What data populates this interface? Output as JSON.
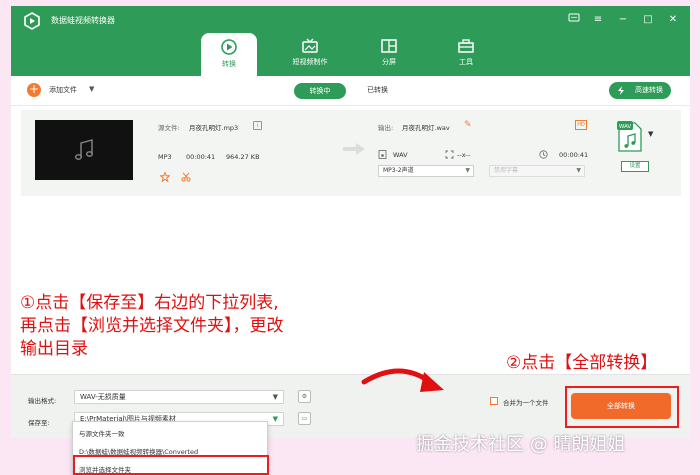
{
  "app": {
    "title": "数据蛙视频转换器"
  },
  "tabs": [
    {
      "label": "转换"
    },
    {
      "label": "短视频制作"
    },
    {
      "label": "分屏"
    },
    {
      "label": "工具"
    }
  ],
  "toolbar": {
    "add_file": "添加文件",
    "converting_tab": "转换中",
    "converted_tab": "已转换",
    "fast_convert": "高速转换"
  },
  "file": {
    "source_label": "源文件:",
    "source_name": "月夜孔明灯.mp3",
    "format": "MP3",
    "duration": "00:00:41",
    "size": "964.27 KB",
    "output_label": "输出:",
    "output_name": "月夜孔明灯.wav",
    "output_format": "WAV",
    "resolution": "--x--",
    "output_duration": "00:00:41",
    "audio_select": "MP3-2声道",
    "subtitle_select": "禁用字幕",
    "format_badge": "WAV",
    "settings": "设置"
  },
  "bottom": {
    "output_format_label": "输出格式:",
    "output_format_value": "WAV-无损质量",
    "save_to_label": "保存至:",
    "save_to_value": "E:\\PrMaterial\\图片与视频素材",
    "merge_label": "合并为一个文件",
    "convert_all": "全部转换"
  },
  "dropdown": {
    "items": [
      "与源文件夹一致",
      "D:\\数据蛙\\数据蛙视频转换器\\Converted",
      "浏览并选择文件夹"
    ]
  },
  "annotations": {
    "step1_line1": "①点击【保存至】右边的下拉列表,",
    "step1_line2": "再点击【浏览并选择文件夹】，更改",
    "step1_line3": "输出目录",
    "step2": "②点击【全部转换】"
  },
  "watermark": "掘金技术社区 @ 晴朗姐姐",
  "colors": {
    "brand_green": "#2e9c58",
    "accent_orange": "#f26a2a",
    "annotation_red": "#e11010",
    "background_pink": "#fbe6f4"
  }
}
